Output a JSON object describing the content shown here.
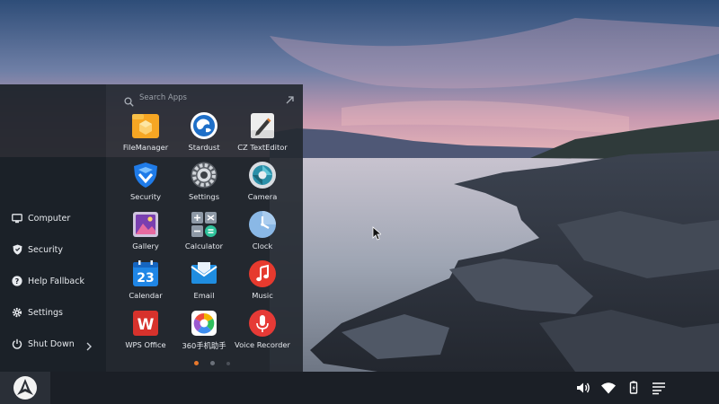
{
  "search": {
    "placeholder": "Search Apps"
  },
  "left_menu": [
    {
      "label": "Computer",
      "icon": "monitor-icon"
    },
    {
      "label": "Security",
      "icon": "shield-icon"
    },
    {
      "label": "Help Fallback",
      "icon": "help-icon"
    },
    {
      "label": "Settings",
      "icon": "gear-icon"
    },
    {
      "label": "Shut Down",
      "icon": "power-icon"
    }
  ],
  "apps": [
    {
      "label": "FileManager",
      "icon": "file-manager-icon"
    },
    {
      "label": "Stardust",
      "icon": "stardust-icon"
    },
    {
      "label": "CZ TextEditor",
      "icon": "text-editor-icon"
    },
    {
      "label": "Security",
      "icon": "security-app-icon"
    },
    {
      "label": "Settings",
      "icon": "settings-app-icon"
    },
    {
      "label": "Camera",
      "icon": "camera-icon"
    },
    {
      "label": "Gallery",
      "icon": "gallery-icon"
    },
    {
      "label": "Calculator",
      "icon": "calculator-icon"
    },
    {
      "label": "Clock",
      "icon": "clock-icon"
    },
    {
      "label": "Calendar",
      "icon": "calendar-icon"
    },
    {
      "label": "Email",
      "icon": "email-icon"
    },
    {
      "label": "Music",
      "icon": "music-icon"
    },
    {
      "label": "WPS Office",
      "icon": "wps-office-icon"
    },
    {
      "label": "360手机助手",
      "icon": "360-assistant-icon"
    },
    {
      "label": "Voice Recorder",
      "icon": "voice-recorder-icon"
    }
  ],
  "apps_extra": {
    "calendar_day": "23",
    "wps_letter": "W"
  },
  "pagination": {
    "pages": 3,
    "current_page": 1,
    "active_color": "#e8782c",
    "inactive_color": "#6b717a"
  },
  "tray": [
    "volume-icon",
    "wifi-icon",
    "battery-icon",
    "notifications-icon"
  ]
}
